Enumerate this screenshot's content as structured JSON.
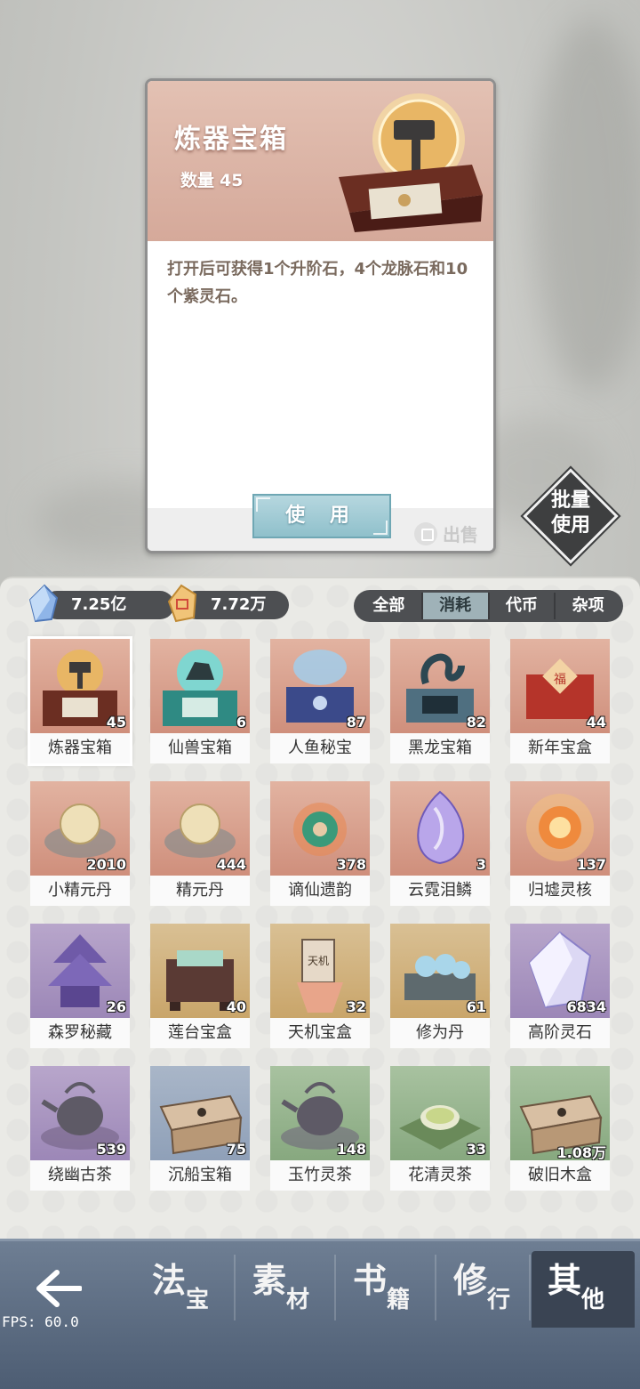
{
  "detail": {
    "title": "炼器宝箱",
    "qty_label": "数量",
    "qty_value": "45",
    "description": "打开后可获得1个升阶石，4个龙脉石和10个紫灵石。",
    "use_label": "使 用",
    "sell_label": "出售"
  },
  "batch_use": {
    "label_line1": "批量",
    "label_line2": "使用"
  },
  "currency": {
    "spirit_stone": "7.25亿",
    "gold_stone": "7.72万"
  },
  "tabs": [
    {
      "label": "全部",
      "active": false
    },
    {
      "label": "消耗",
      "active": true
    },
    {
      "label": "代币",
      "active": false
    },
    {
      "label": "杂项",
      "active": false
    }
  ],
  "items": [
    {
      "name": "炼器宝箱",
      "count": "45",
      "bg": "red",
      "icon": "hammer-chest-icon",
      "selected": true
    },
    {
      "name": "仙兽宝箱",
      "count": "6",
      "bg": "red",
      "icon": "beast-chest-icon"
    },
    {
      "name": "人鱼秘宝",
      "count": "87",
      "bg": "red",
      "icon": "mermaid-chest-icon"
    },
    {
      "name": "黑龙宝箱",
      "count": "82",
      "bg": "red",
      "icon": "dragon-chest-icon"
    },
    {
      "name": "新年宝盒",
      "count": "44",
      "bg": "red",
      "icon": "newyear-box-icon"
    },
    {
      "name": "小精元丹",
      "count": "2010",
      "bg": "red",
      "icon": "pill-icon"
    },
    {
      "name": "精元丹",
      "count": "444",
      "bg": "red",
      "icon": "pill-icon"
    },
    {
      "name": "谪仙遗韵",
      "count": "378",
      "bg": "red",
      "icon": "jade-icon"
    },
    {
      "name": "云霓泪鳞",
      "count": "3",
      "bg": "red",
      "icon": "teardrop-scale-icon"
    },
    {
      "name": "归墟灵核",
      "count": "137",
      "bg": "red",
      "icon": "core-orb-icon"
    },
    {
      "name": "森罗秘藏",
      "count": "26",
      "bg": "purple",
      "icon": "pagoda-icon"
    },
    {
      "name": "莲台宝盒",
      "count": "40",
      "bg": "gold",
      "icon": "lotus-box-icon"
    },
    {
      "name": "天机宝盒",
      "count": "32",
      "bg": "gold",
      "icon": "tianji-box-icon"
    },
    {
      "name": "修为丹",
      "count": "61",
      "bg": "gold",
      "icon": "pill-tray-icon"
    },
    {
      "name": "高阶灵石",
      "count": "6834",
      "bg": "purple",
      "icon": "spirit-stone-icon"
    },
    {
      "name": "绕幽古茶",
      "count": "539",
      "bg": "purple",
      "icon": "teapot-icon"
    },
    {
      "name": "沉船宝箱",
      "count": "75",
      "bg": "blue",
      "icon": "wood-chest-icon"
    },
    {
      "name": "玉竹灵茶",
      "count": "148",
      "bg": "green",
      "icon": "teapot-icon"
    },
    {
      "name": "花清灵茶",
      "count": "33",
      "bg": "green",
      "icon": "tea-cup-icon"
    },
    {
      "name": "破旧木盒",
      "count": "1.08万",
      "bg": "green",
      "icon": "wood-chest-icon"
    }
  ],
  "nav": [
    {
      "big": "法",
      "small": "宝",
      "active": false
    },
    {
      "big": "素",
      "small": "材",
      "active": false
    },
    {
      "big": "书",
      "small": "籍",
      "active": false
    },
    {
      "big": "修",
      "small": "行",
      "active": false
    },
    {
      "big": "其",
      "small": "他",
      "active": true
    }
  ],
  "fps": "FPS: 60.0"
}
